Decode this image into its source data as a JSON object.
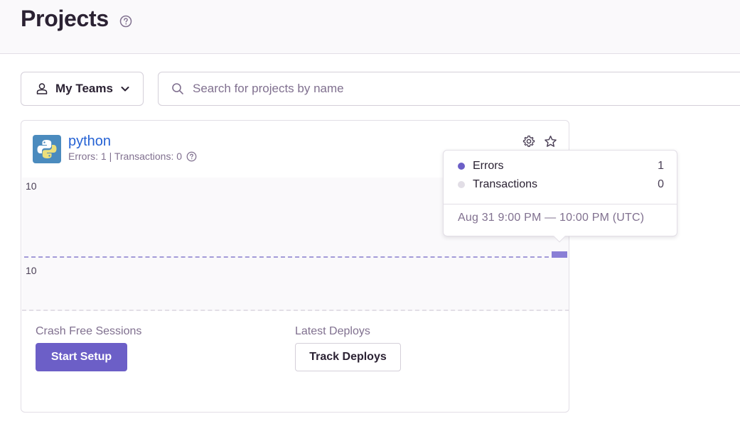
{
  "header": {
    "title": "Projects"
  },
  "filters": {
    "teams_label": "My Teams",
    "search_placeholder": "Search for projects by name"
  },
  "project": {
    "name": "python",
    "stats": "Errors: 1 | Transactions: 0",
    "chart": {
      "ticks": [
        "10",
        "10"
      ]
    },
    "crash_free_label": "Crash Free Sessions",
    "start_setup_label": "Start Setup",
    "deploys_label": "Latest Deploys",
    "track_deploys_label": "Track Deploys"
  },
  "tooltip": {
    "series": [
      {
        "name": "Errors",
        "value": "1",
        "color": "#6c5fc7"
      },
      {
        "name": "Transactions",
        "value": "0",
        "color": "#e2dee6"
      }
    ],
    "date_range": "Aug 31 9:00 PM — 10:00 PM (UTC)"
  },
  "icons": {
    "help": "question-circle-icon",
    "user": "user-icon",
    "chevron": "chevron-down-icon",
    "search": "search-icon",
    "settings": "gear-icon",
    "bookmark": "star-icon",
    "logo": "python-logo-icon"
  }
}
